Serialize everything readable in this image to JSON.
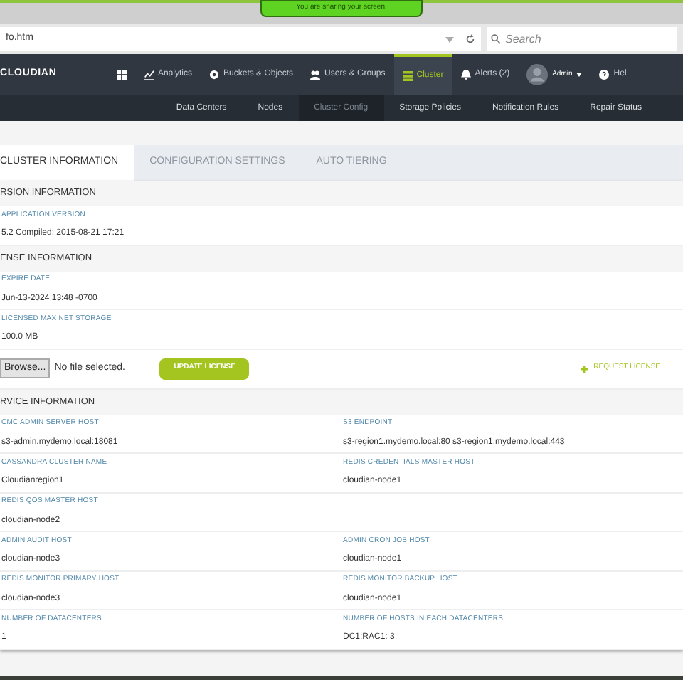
{
  "share_banner": "You are sharing your screen.",
  "browser": {
    "url": "fo.htm",
    "search_placeholder": "Search"
  },
  "nav": {
    "logo": "CLOUDIAN",
    "items": [
      {
        "kind": "grid",
        "selected": false
      },
      {
        "kind": "chart",
        "label": "Analytics",
        "selected": false
      },
      {
        "kind": "gear",
        "label": "Buckets & Objects",
        "selected": false
      },
      {
        "kind": "users",
        "label": "Users & Groups",
        "selected": false
      },
      {
        "kind": "cluster",
        "label": "Cluster",
        "selected": true
      },
      {
        "kind": "bell",
        "label": "Alerts (2)",
        "selected": false
      },
      {
        "kind": "user",
        "label": "Admin",
        "selected": false
      },
      {
        "kind": "help",
        "label": "Hel",
        "selected": false
      }
    ]
  },
  "subnav": [
    {
      "label": "Data Centers",
      "selected": false
    },
    {
      "label": "Nodes",
      "selected": false
    },
    {
      "label": "Cluster Config",
      "selected": true
    },
    {
      "label": "Storage Policies",
      "selected": false
    },
    {
      "label": "Notification Rules",
      "selected": false
    },
    {
      "label": "Repair Status",
      "selected": false
    }
  ],
  "tabs": [
    {
      "label": "CLUSTER INFORMATION",
      "selected": true
    },
    {
      "label": "CONFIGURATION SETTINGS",
      "selected": false
    },
    {
      "label": "AUTO TIERING",
      "selected": false
    }
  ],
  "sections": [
    {
      "title": "RSION INFORMATION",
      "rows": [
        [
          {
            "label": "APPLICATION VERSION",
            "value": "5.2 Compiled: 2015-08-21 17:21"
          }
        ]
      ]
    },
    {
      "title": "ENSE INFORMATION",
      "rows": [
        [
          {
            "label": "EXPIRE DATE",
            "value": "Jun-13-2024 13:48 -0700"
          }
        ],
        [
          {
            "label": "LICENSED MAX NET STORAGE",
            "value": "100.0 MB"
          }
        ]
      ],
      "upload": {
        "browse": "Browse...",
        "file_status": "No file selected.",
        "update": "UPDATE LICENSE",
        "request": "REQUEST LICENSE"
      }
    },
    {
      "title": "RVICE INFORMATION",
      "rows": [
        [
          {
            "label": "CMC ADMIN SERVER HOST",
            "value": "s3-admin.mydemo.local:18081"
          },
          {
            "label": "S3 ENDPOINT",
            "value": "s3-region1.mydemo.local:80 s3-region1.mydemo.local:443"
          }
        ],
        [
          {
            "label": "CASSANDRA CLUSTER NAME",
            "value": "Cloudianregion1"
          },
          {
            "label": "REDIS CREDENTIALS MASTER HOST",
            "value": "cloudian-node1"
          }
        ],
        [
          {
            "label": "REDIS QOS MASTER HOST",
            "value": "cloudian-node2"
          }
        ],
        [
          {
            "label": "ADMIN AUDIT HOST",
            "value": "cloudian-node3"
          },
          {
            "label": "ADMIN CRON JOB HOST",
            "value": "cloudian-node1"
          }
        ],
        [
          {
            "label": "REDIS MONITOR PRIMARY HOST",
            "value": "cloudian-node3"
          },
          {
            "label": "REDIS MONITOR BACKUP HOST",
            "value": "cloudian-node1"
          }
        ],
        [
          {
            "label": "NUMBER OF DATACENTERS",
            "value": "1"
          },
          {
            "label": "NUMBER OF HOSTS IN EACH DATACENTERS",
            "value": "DC1:RAC1: 3"
          }
        ]
      ]
    }
  ]
}
